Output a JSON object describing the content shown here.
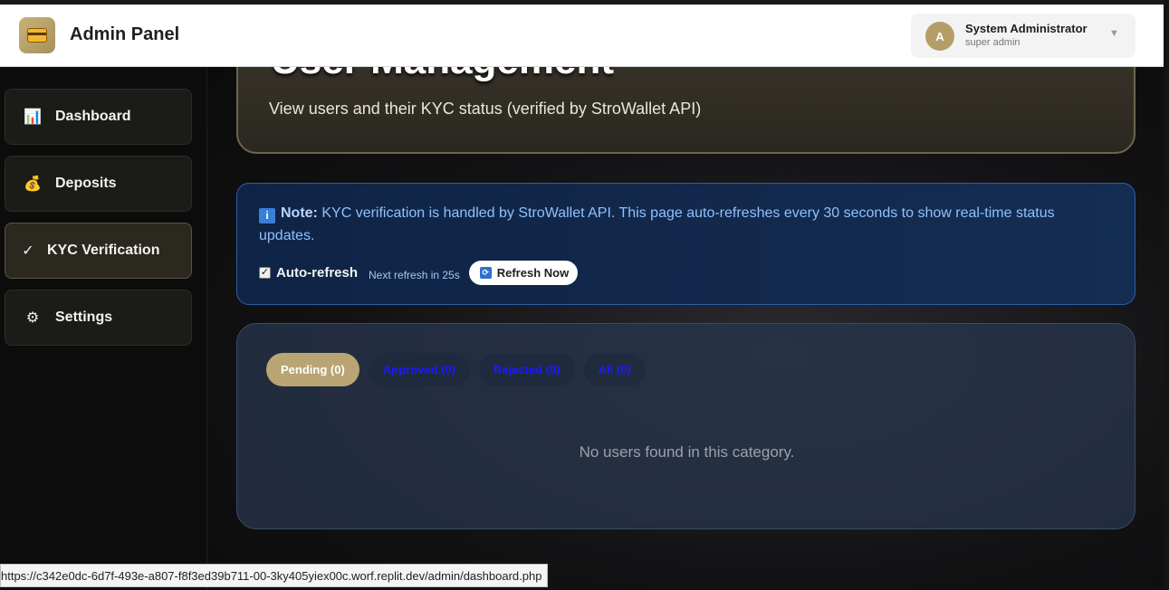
{
  "header": {
    "app_title": "Admin Panel",
    "logo_icon": "credit-card-icon",
    "user": {
      "avatar_letter": "A",
      "name": "System Administrator",
      "role": "super admin"
    }
  },
  "sidebar": {
    "items": [
      {
        "label": "Dashboard",
        "icon": "bar-chart-icon",
        "glyph": "📊",
        "active": false
      },
      {
        "label": "Deposits",
        "icon": "money-bag-icon",
        "glyph": "💰",
        "active": false
      },
      {
        "label": "KYC Verification",
        "icon": "check-icon",
        "glyph": "✓",
        "active": true
      },
      {
        "label": "Settings",
        "icon": "gear-icon",
        "glyph": "⚙",
        "active": false
      }
    ]
  },
  "main": {
    "hero_title": "User Management",
    "hero_subtitle": "View users and their KYC status (verified by StroWallet API)",
    "note": {
      "label": "Note:",
      "text": "KYC verification is handled by StroWallet API. This page auto-refreshes every 30 seconds to show real-time status updates.",
      "auto_refresh_label": "Auto-refresh",
      "auto_refresh_checked": true,
      "next_refresh": "Next refresh in 25s",
      "refresh_button": "Refresh Now"
    },
    "tabs": [
      {
        "label": "Pending (0)",
        "active": true
      },
      {
        "label": "Approved (0)",
        "active": false
      },
      {
        "label": "Rejected (0)",
        "active": false
      },
      {
        "label": "All (0)",
        "active": false
      }
    ],
    "empty_message": "No users found in this category."
  },
  "status_bar": {
    "url": "https://c342e0dc-6d7f-493e-a807-f8f3ed39b711-00-3ky405yiex00c.worf.replit.dev/admin/dashboard.php"
  },
  "colors": {
    "accent_gold": "#b9a474",
    "note_blue": "#8fc0ff",
    "tab_link": "#1a1aff"
  }
}
